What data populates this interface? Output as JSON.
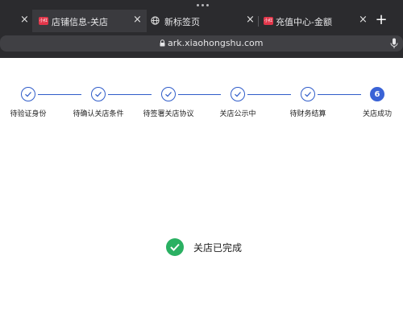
{
  "browser": {
    "tabs": [
      {
        "title": "店铺信息-关店",
        "favicon": "xiaohongshu-logo-icon",
        "active": true
      },
      {
        "title": "新标签页",
        "favicon": "globe-icon",
        "active": false
      },
      {
        "title": "充值中心-金额",
        "favicon": "xiaohongshu-logo-icon",
        "active": false
      }
    ],
    "favicon_text": "小红书",
    "new_tab_label": "+",
    "close_label": "×",
    "url": "ark.xiaohongshu.com"
  },
  "steps": [
    {
      "label": "待验证身份",
      "status": "done"
    },
    {
      "label": "待确认关店条件",
      "status": "done"
    },
    {
      "label": "待签署关店协议",
      "status": "done"
    },
    {
      "label": "关店公示中",
      "status": "done"
    },
    {
      "label": "待财务结算",
      "status": "done"
    },
    {
      "label": "关店成功",
      "status": "current",
      "number": "6"
    }
  ],
  "result": {
    "text": "关店已完成",
    "icon": "check-circle-icon",
    "color": "#2ab062"
  },
  "colors": {
    "accent": "#3a63d6",
    "chrome": "#2b2b2e"
  }
}
